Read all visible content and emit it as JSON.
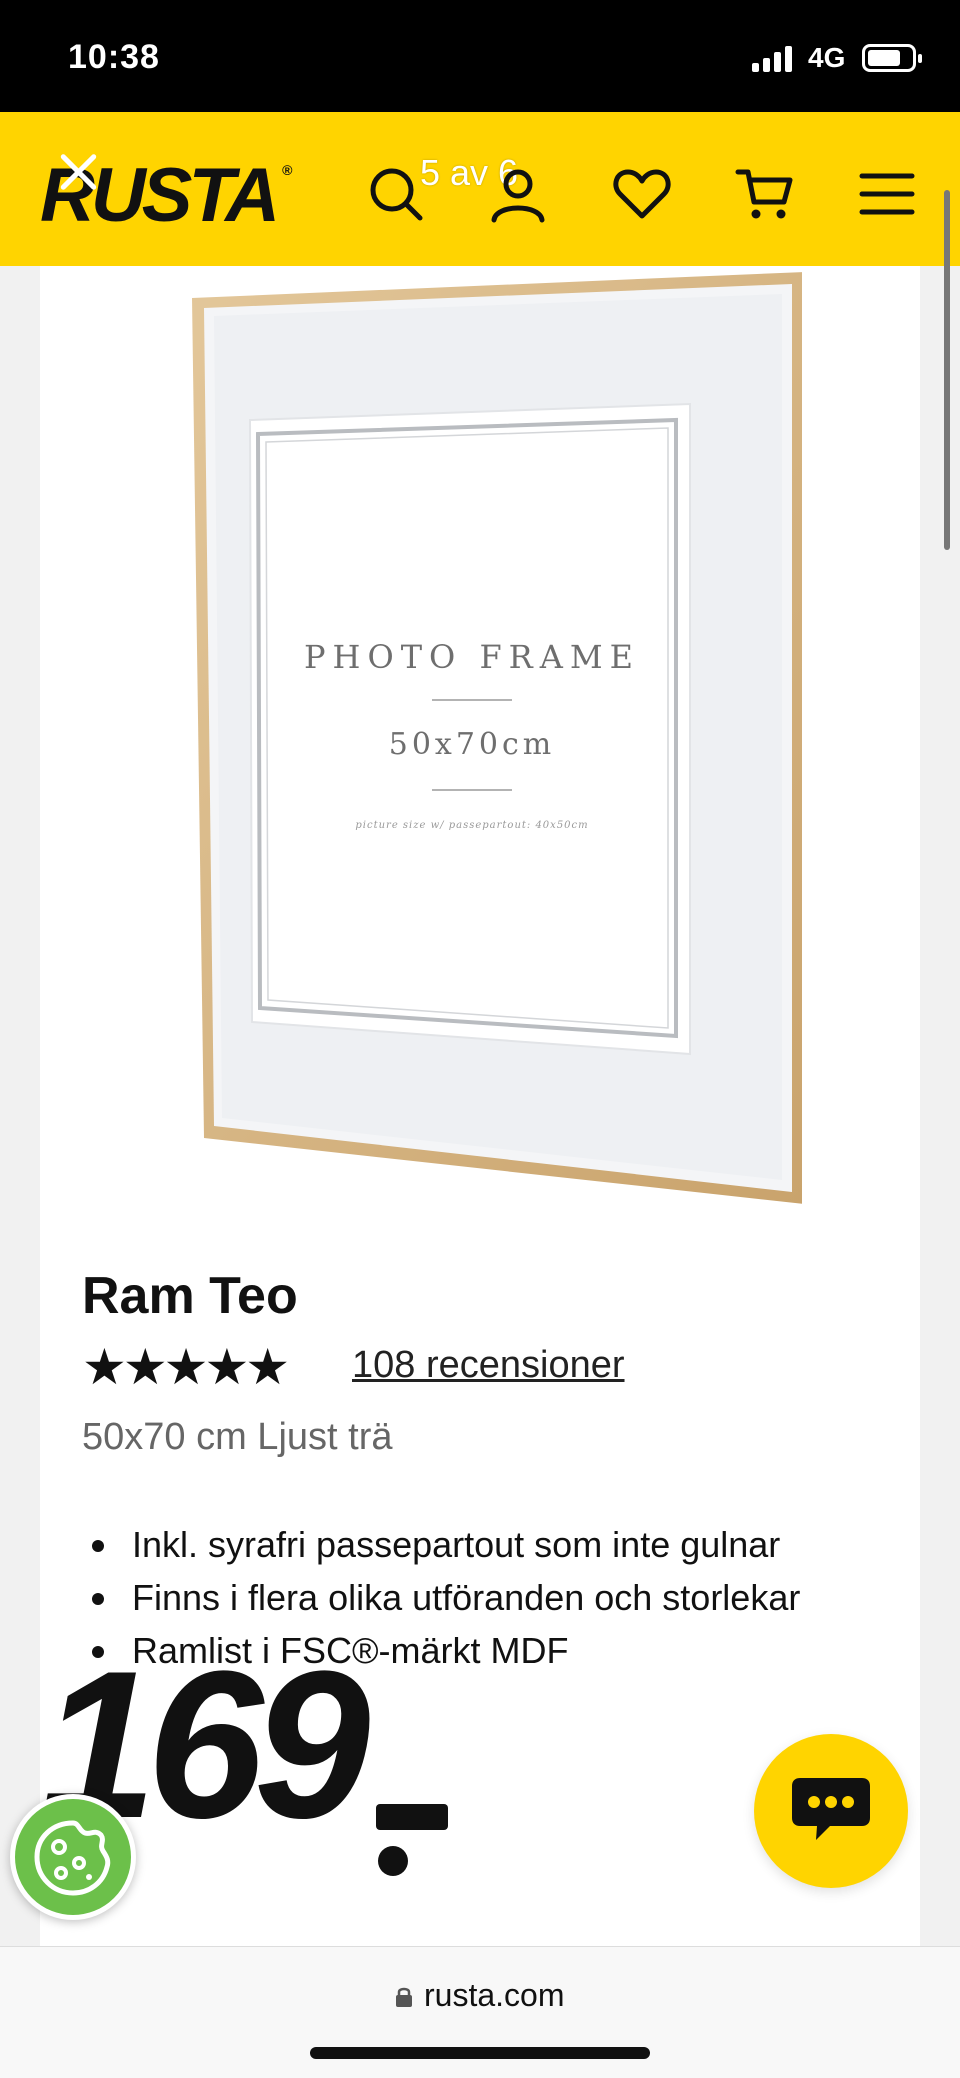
{
  "status_bar": {
    "time": "10:38",
    "network": "4G"
  },
  "header": {
    "logo": "RUSTA",
    "logo_mark": "®",
    "image_counter": "5 av 6",
    "icons": [
      "close-icon",
      "search-icon",
      "user-icon",
      "heart-icon",
      "cart-icon",
      "menu-icon"
    ]
  },
  "product_image": {
    "frame_heading": "PHOTO FRAME",
    "frame_size": "50x70cm",
    "frame_note": "picture size w/ passepartout: 40x50cm"
  },
  "product": {
    "title": "Ram Teo",
    "rating_stars": 4.5,
    "stars_display": "★★★★★",
    "reviews": "108 recensioner",
    "variant": "50x70 cm Ljust trä",
    "features": [
      "Inkl. syrafri passepartout som inte gulnar",
      "Finns i flera olika utföranden och storlekar",
      "Ramlist i FSC®-märkt MDF"
    ],
    "price": "169"
  },
  "floating": {
    "chat_icon": "chat-bubble-icon",
    "cookie_icon": "cookie-icon"
  },
  "browser": {
    "url": "rusta.com"
  },
  "colors": {
    "brand_yellow": "#ffd400",
    "cookie_green": "#6cc04a",
    "text_dark": "#111111"
  }
}
